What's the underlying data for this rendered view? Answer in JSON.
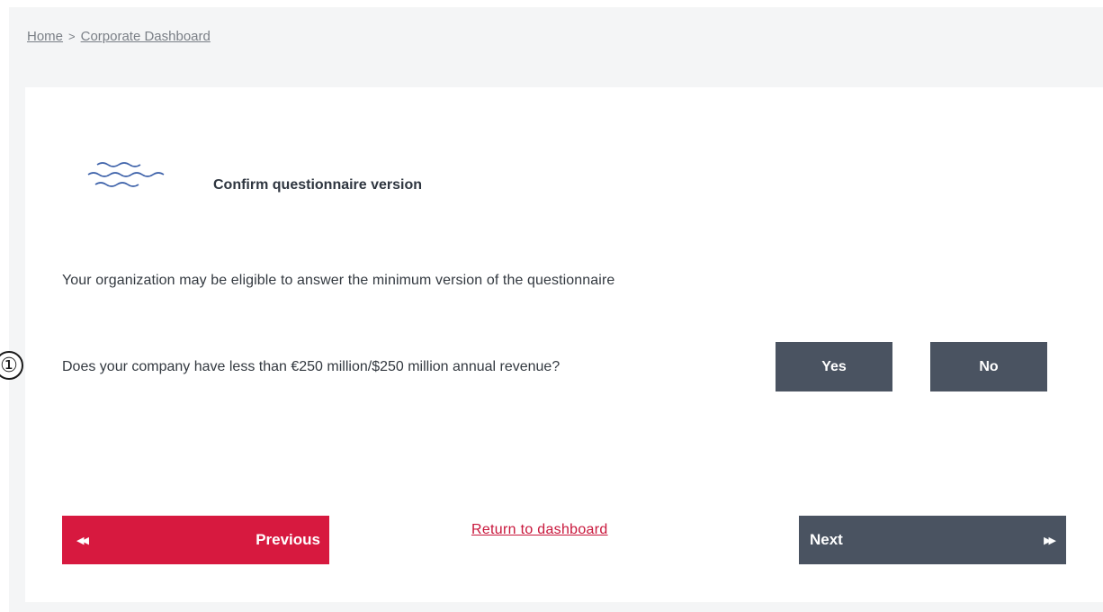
{
  "breadcrumb": {
    "home": "Home",
    "separator": ">",
    "current": "Corporate Dashboard"
  },
  "card": {
    "icon": "wave-icon",
    "title": "Confirm questionnaire version",
    "intro": "Your organization may be eligible to answer the minimum version of the questionnaire"
  },
  "question": {
    "marker": "①",
    "text": "Does your company have less than €250 million/$250 million annual revenue?",
    "yes_label": "Yes",
    "no_label": "No"
  },
  "navigation": {
    "previous_label": "Previous",
    "previous_icon": "double-left-arrow-icon",
    "return_label": "Return to dashboard",
    "next_label": "Next",
    "next_icon": "double-right-arrow-icon"
  },
  "colors": {
    "background": "#f4f5f6",
    "card": "#ffffff",
    "accent_red": "#d7193f",
    "button_dark": "#4a5361",
    "icon_blue": "#3a5fa8"
  }
}
